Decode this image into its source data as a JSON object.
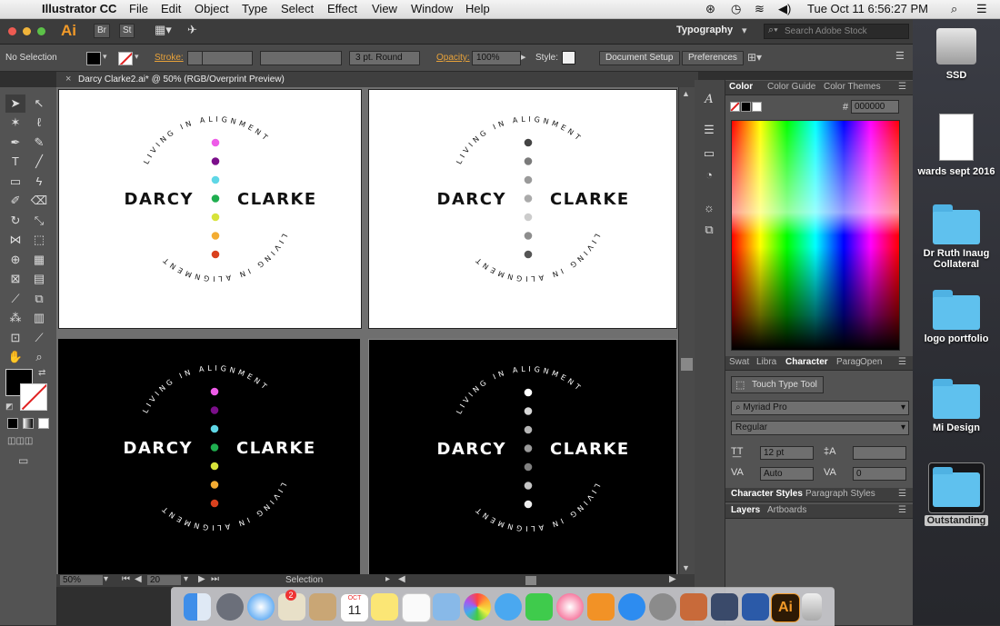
{
  "menubar": {
    "app": "Illustrator CC",
    "items": [
      "File",
      "Edit",
      "Object",
      "Type",
      "Select",
      "Effect",
      "View",
      "Window",
      "Help"
    ],
    "clock": "Tue Oct 11  6:56:27 PM"
  },
  "appbar": {
    "logo": "Ai",
    "br": "Br",
    "st": "St",
    "workspace": "Typography",
    "search_placeholder": "Search Adobe Stock"
  },
  "control_bar": {
    "selection": "No Selection",
    "stroke_label": "Stroke:",
    "brush": "3 pt. Round",
    "opacity_label": "Opacity:",
    "opacity_value": "100%",
    "style_label": "Style:",
    "doc_setup": "Document Setup",
    "preferences": "Preferences"
  },
  "document": {
    "tab_title": "Darcy Clarke2.ai* @ 50% (RGB/Overprint Preview)",
    "close": "×"
  },
  "artwork": {
    "name_left": "DARCY",
    "name_right": "CLARKE",
    "arc_top": "LIVING IN ALIGNMENT",
    "arc_bottom": "LIVING IN ALIGNMENT",
    "dot_colors_color": [
      "#ee5ce8",
      "#7b0f8a",
      "#5fd7e6",
      "#1fae4f",
      "#d7e33a",
      "#f3ac32",
      "#d9411e"
    ],
    "dot_colors_gray_on_white": [
      "#444444",
      "#7a7a7a",
      "#9a9a9a",
      "#aaaaaa",
      "#cccccc",
      "#8d8d8d",
      "#555555"
    ],
    "dot_colors_gray_on_black": [
      "#ffffff",
      "#d7d7d7",
      "#b5b5b5",
      "#9a9a9a",
      "#808080",
      "#c5c5c5",
      "#eeeeee"
    ]
  },
  "status": {
    "zoom": "50%",
    "artboard": "20",
    "mode": "Selection"
  },
  "panels": {
    "color_tabs": [
      "Color",
      "Color Guide",
      "Color Themes"
    ],
    "hex_label": "#",
    "hex_value": "000000",
    "char_tabs": [
      "Swat",
      "Libra",
      "Character",
      "Parag",
      "Open"
    ],
    "touch_type": "Touch Type Tool",
    "font_family": "Myriad Pro",
    "font_style": "Regular",
    "font_size": "12 pt",
    "leading": "",
    "kerning": "Auto",
    "tracking": "0",
    "styles_tabs": [
      "Character Styles",
      "Paragraph Styles"
    ],
    "layers_tabs": [
      "Layers",
      "Artboards"
    ]
  },
  "desktop": {
    "items": [
      "SSD",
      "wards sept 2016",
      "Dr Ruth Inaug Collateral",
      "logo portfolio",
      "Mi Design",
      "Outstanding"
    ]
  },
  "dock": {
    "calendar_month": "OCT",
    "calendar_day": "11",
    "badge": "2",
    "ai_label": "Ai"
  }
}
